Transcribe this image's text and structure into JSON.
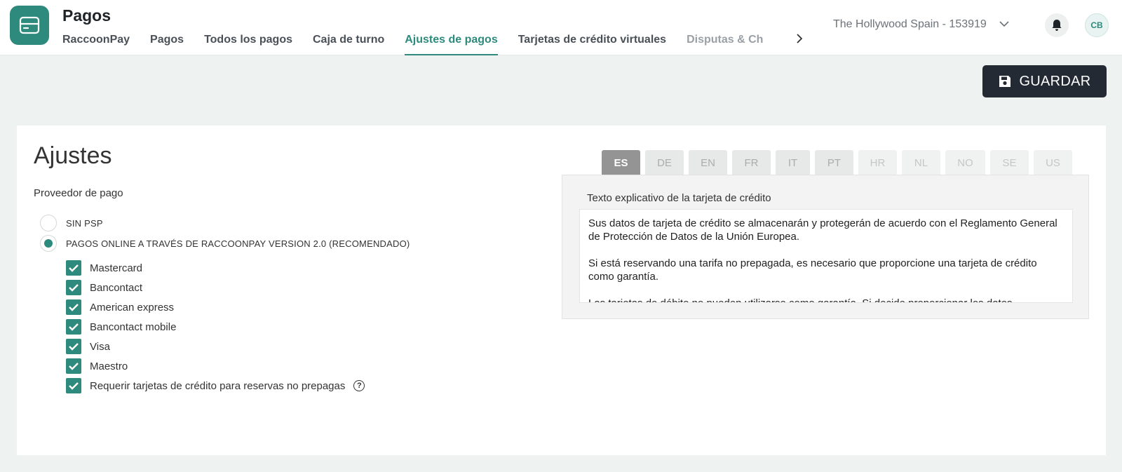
{
  "header": {
    "app_title": "Pagos",
    "tabs": [
      {
        "label": "RaccoonPay"
      },
      {
        "label": "Pagos"
      },
      {
        "label": "Todos los pagos"
      },
      {
        "label": "Caja de turno"
      },
      {
        "label": "Ajustes de pagos"
      },
      {
        "label": "Tarjetas de crédito virtuales"
      },
      {
        "label": "Disputas & Ch"
      }
    ],
    "active_tab": "Ajustes de pagos",
    "property_name": "The Hollywood Spain - 153919",
    "avatar_initials": "CB"
  },
  "toolbar": {
    "save_label": "GUARDAR"
  },
  "settings": {
    "title": "Ajustes",
    "provider_label": "Proveedor de pago",
    "providers": [
      {
        "label": "SIN PSP",
        "selected": false
      },
      {
        "label": "PAGOS ONLINE A TRAVÉS DE RACCOONPAY VERSION 2.0 (RECOMENDADO)",
        "selected": true
      }
    ],
    "options": [
      {
        "label": "Mastercard",
        "checked": true
      },
      {
        "label": "Bancontact",
        "checked": true
      },
      {
        "label": "American express",
        "checked": true
      },
      {
        "label": "Bancontact mobile",
        "checked": true
      },
      {
        "label": "Visa",
        "checked": true
      },
      {
        "label": "Maestro",
        "checked": true
      },
      {
        "label": "Requerir tarjetas de crédito para reservas no prepagas",
        "checked": true
      }
    ]
  },
  "languages": {
    "tabs": [
      "ES",
      "DE",
      "EN",
      "FR",
      "IT",
      "PT",
      "HR",
      "NL",
      "NO",
      "SE",
      "US"
    ],
    "active": "ES"
  },
  "explanation": {
    "label": "Texto explicativo de la tarjeta de crédito",
    "paragraphs": [
      "Sus datos de tarjeta de crédito se almacenarán y protegerán de acuerdo con el Reglamento General de Protección de Datos de la Unión Europea.",
      "Si está reservando una tarifa no prepagada, es necesario que proporcione una tarjeta de crédito como garantía.",
      "Las tarjetas de débito no pueden utilizarse como garantía. Si decide proporcionar los datos"
    ]
  },
  "colors": {
    "accent": "#2d8a7c",
    "dark_button": "#232a33"
  }
}
